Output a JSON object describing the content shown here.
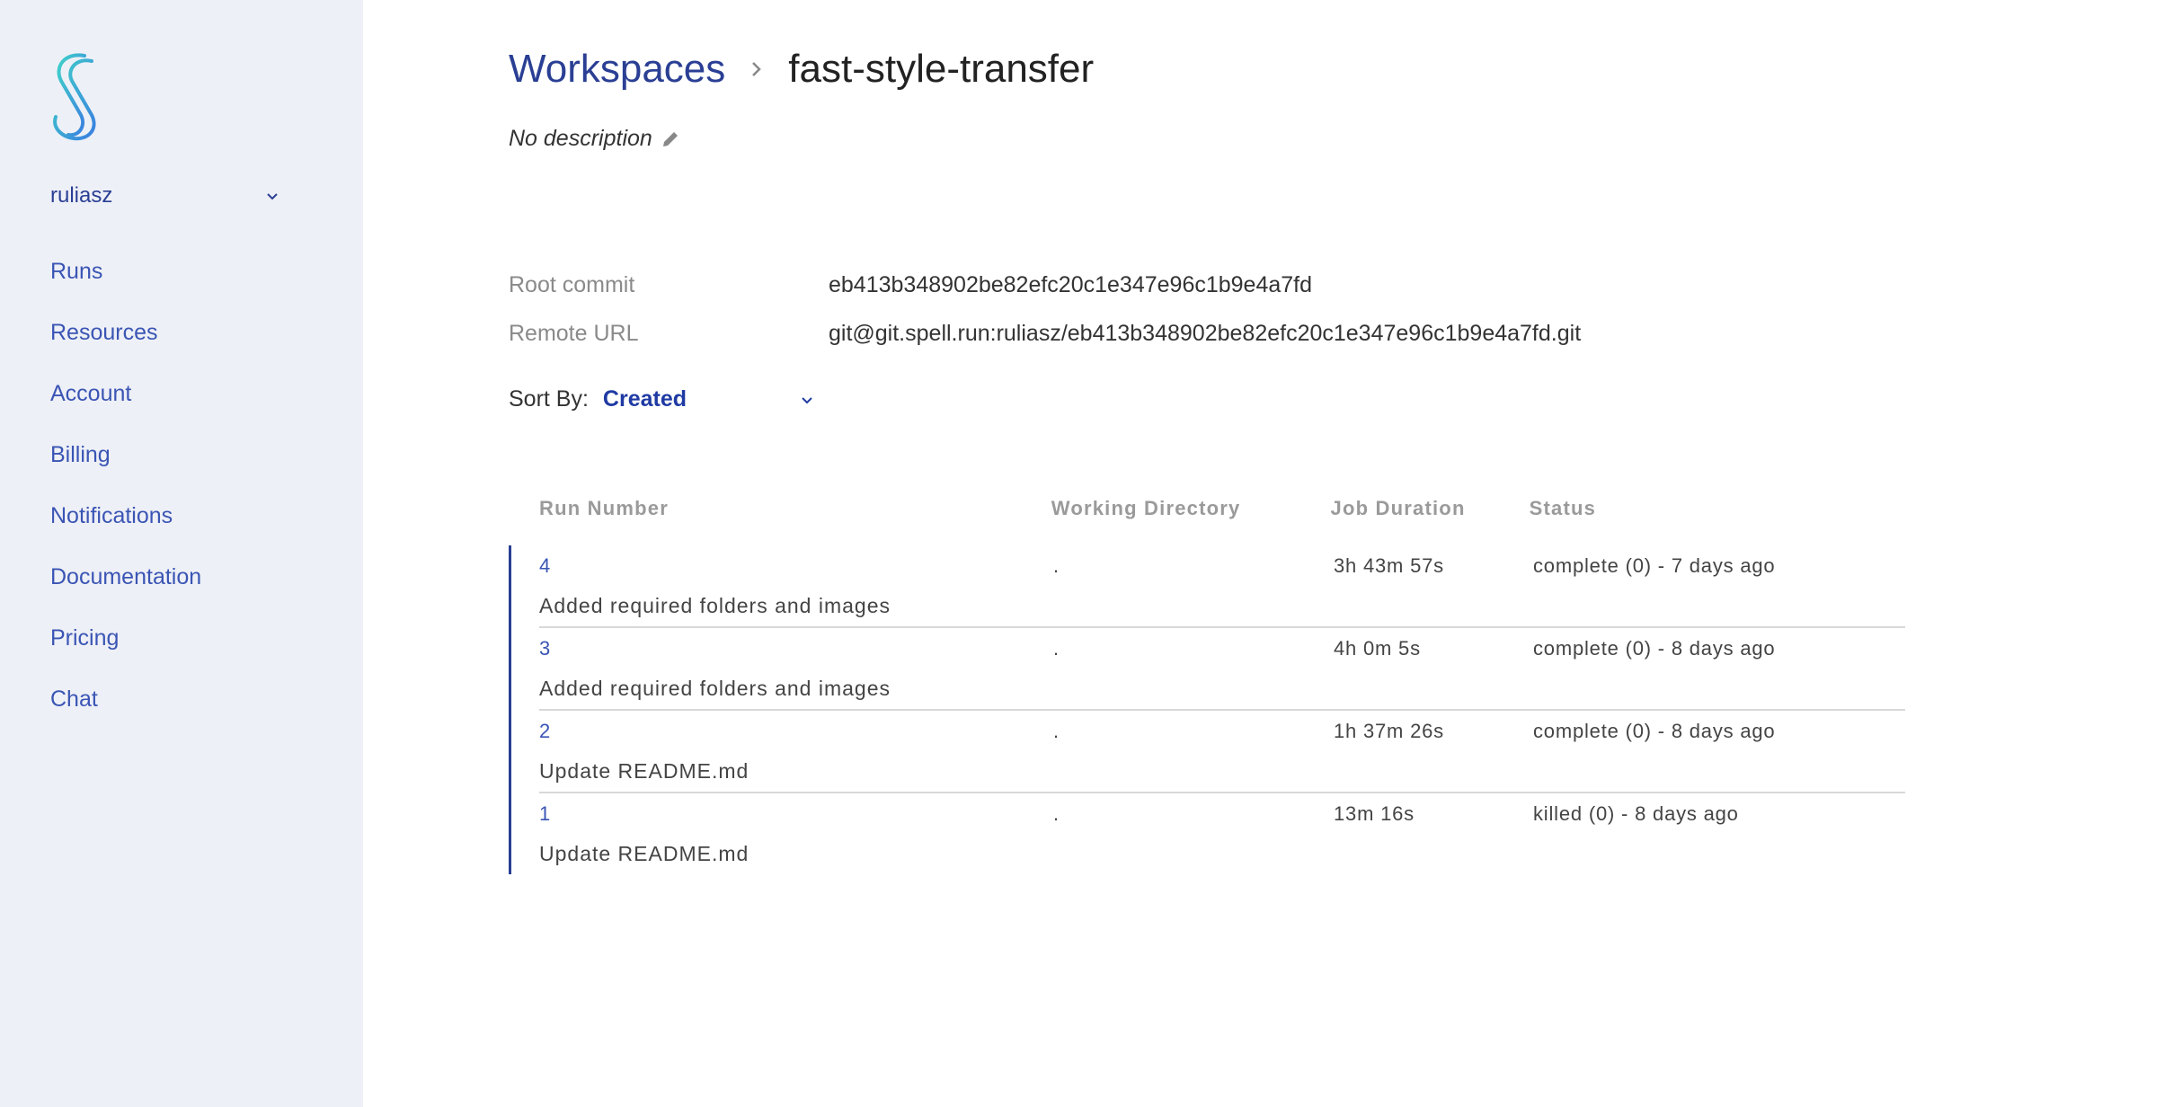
{
  "sidebar": {
    "user": "ruliasz",
    "nav": [
      "Runs",
      "Resources",
      "Account",
      "Billing",
      "Notifications",
      "Documentation",
      "Pricing",
      "Chat"
    ]
  },
  "header": {
    "breadcrumb_root": "Workspaces",
    "workspace_name": "fast-style-transfer",
    "description": "No description"
  },
  "info": {
    "root_commit_label": "Root commit",
    "root_commit_value": "eb413b348902be82efc20c1e347e96c1b9e4a7fd",
    "remote_url_label": "Remote URL",
    "remote_url_value": "git@git.spell.run:ruliasz/eb413b348902be82efc20c1e347e96c1b9e4a7fd.git"
  },
  "sort": {
    "label": "Sort By:",
    "value": "Created"
  },
  "table": {
    "headers": [
      "Run Number",
      "Working Directory",
      "Job Duration",
      "Status"
    ],
    "rows": [
      {
        "run": "4",
        "dir": ".",
        "duration": "3h 43m 57s",
        "status": "complete (0) - 7 days ago",
        "message": "Added required folders and images"
      },
      {
        "run": "3",
        "dir": ".",
        "duration": "4h 0m 5s",
        "status": "complete (0) - 8 days ago",
        "message": "Added required folders and images"
      },
      {
        "run": "2",
        "dir": ".",
        "duration": "1h 37m 26s",
        "status": "complete (0) - 8 days ago",
        "message": "Update README.md"
      },
      {
        "run": "1",
        "dir": ".",
        "duration": "13m 16s",
        "status": "killed (0) - 8 days ago",
        "message": "Update README.md"
      }
    ]
  },
  "colors": {
    "accent": "#2a3f94",
    "link": "#3a55b4",
    "sidebar_bg": "#eef0f7",
    "logo_start": "#3fd1c9",
    "logo_end": "#3a7fe0"
  },
  "icons": [
    "spell-logo",
    "chevron-down-icon",
    "chevron-right-icon",
    "pencil-icon"
  ]
}
